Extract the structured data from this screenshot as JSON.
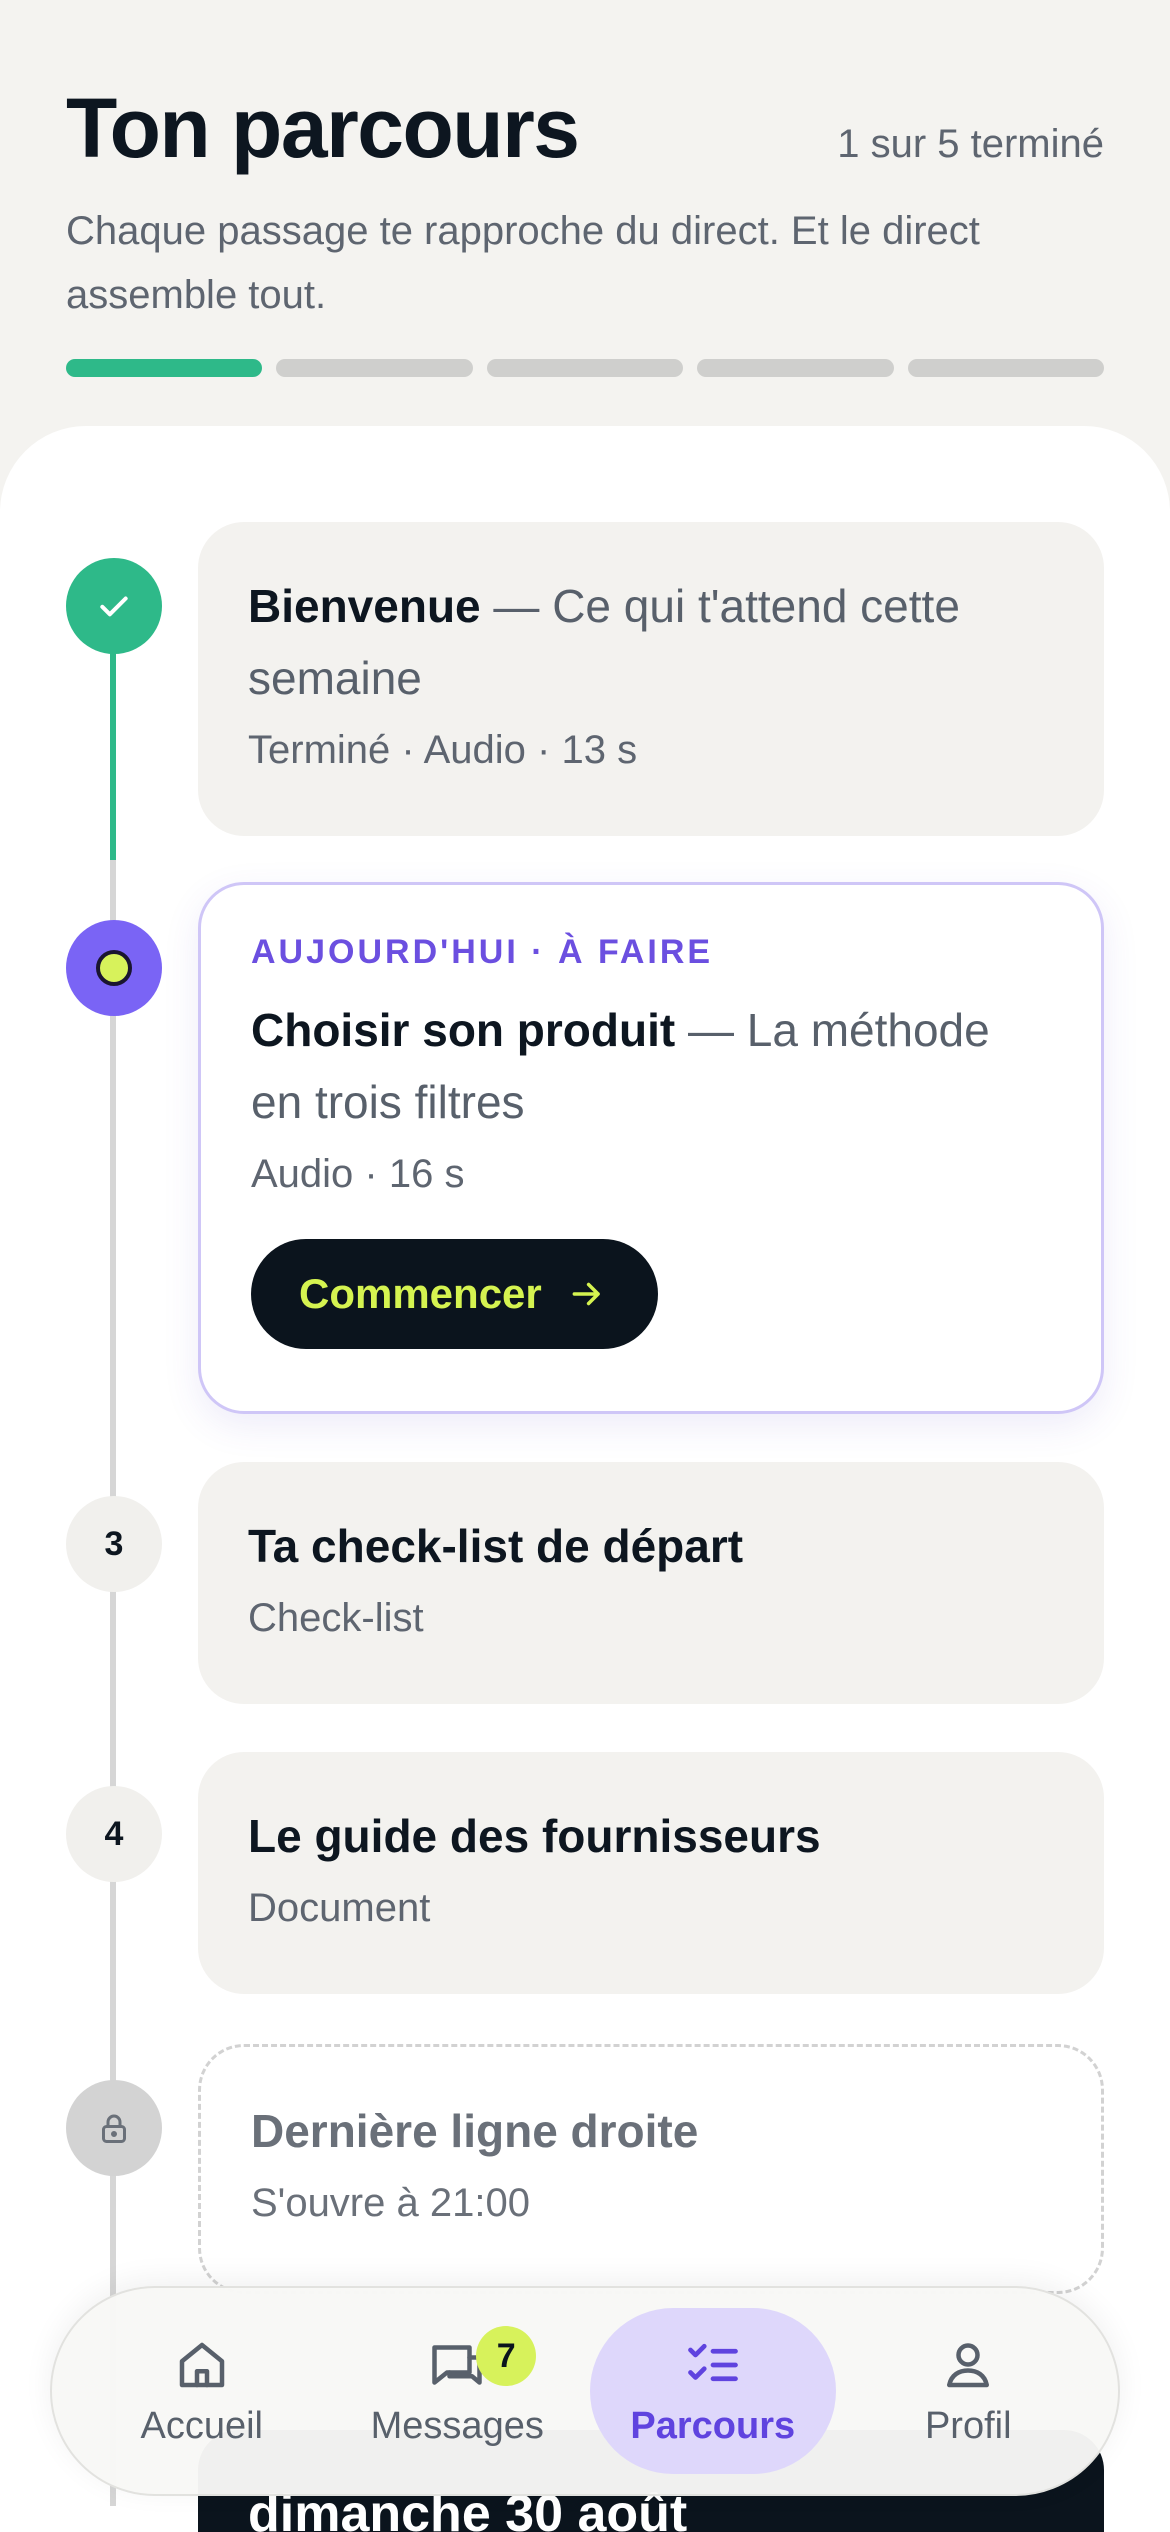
{
  "header": {
    "title": "Ton parcours",
    "progress_text": "1 sur 5 terminé",
    "subtitle": "Chaque passage te rapproche du direct. Et le direct assemble tout.",
    "progress": {
      "completed": 1,
      "total": 5
    }
  },
  "steps": [
    {
      "status": "done",
      "title": "Bienvenue",
      "title_rest": " — Ce qui t'attend cette semaine",
      "meta": "Terminé · Audio · 13 s"
    },
    {
      "status": "current",
      "eyebrow": "AUJOURD'HUI · À FAIRE",
      "title": "Choisir son produit",
      "title_rest": " — La méthode en trois filtres",
      "meta": "Audio · 16 s",
      "button_label": "Commencer"
    },
    {
      "status": "todo",
      "number": "3",
      "title": "Ta check-list de départ",
      "meta": "Check-list"
    },
    {
      "status": "todo",
      "number": "4",
      "title": "Le guide des fournisseurs",
      "meta": "Document"
    },
    {
      "status": "locked",
      "title": "Dernière ligne droite",
      "meta": "S'ouvre à 21:00"
    }
  ],
  "peek_card_text": "dimanche 30 août",
  "nav": {
    "items": [
      {
        "label": "Accueil",
        "icon": "home-icon"
      },
      {
        "label": "Messages",
        "icon": "messages-icon",
        "badge": "7"
      },
      {
        "label": "Parcours",
        "icon": "checklist-icon",
        "active": true
      },
      {
        "label": "Profil",
        "icon": "user-icon"
      }
    ]
  },
  "colors": {
    "background": "#f4f3f0",
    "accent_green": "#2eb989",
    "accent_purple": "#7a64f5",
    "accent_lime": "#d7f25b",
    "dark": "#0b141d"
  }
}
